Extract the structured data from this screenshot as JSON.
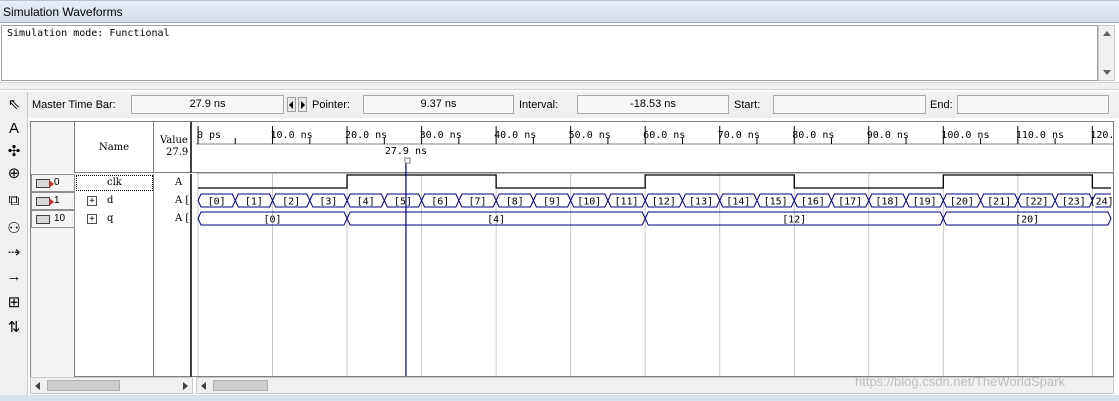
{
  "window": {
    "title": "Simulation Waveforms"
  },
  "messages": {
    "text": "Simulation mode: Functional"
  },
  "toolbar": {
    "tools": [
      {
        "name": "pointer-tool-icon",
        "glyph": "⇖"
      },
      {
        "name": "text-tool-icon",
        "glyph": "A"
      },
      {
        "name": "waveform-edit-icon",
        "glyph": "✣"
      },
      {
        "name": "zoom-tool-icon",
        "glyph": "⊕"
      },
      {
        "name": "copy-icon",
        "glyph": "⧉"
      },
      {
        "name": "find-icon",
        "glyph": "⚇"
      },
      {
        "name": "find-next-icon",
        "glyph": "⇢"
      },
      {
        "name": "next-transition-icon",
        "glyph": "→"
      },
      {
        "name": "group-icon",
        "glyph": "⊞"
      },
      {
        "name": "sort-icon",
        "glyph": "⇅"
      }
    ]
  },
  "timebar": {
    "master_label": "Master Time Bar:",
    "master_value": "27.9 ns",
    "pointer_label": "Pointer:",
    "pointer_value": "9.37 ns",
    "interval_label": "Interval:",
    "interval_value": "-18.53 ns",
    "start_label": "Start:",
    "start_value": "",
    "end_label": "End:",
    "end_value": ""
  },
  "columns": {
    "name": "Name",
    "value_line1": "Value",
    "value_line2": "27.9"
  },
  "signals": [
    {
      "id": "0",
      "name": "clk",
      "value": "A",
      "type": "in",
      "bus": false
    },
    {
      "id": "1",
      "name": "d",
      "value": "A [",
      "type": "in",
      "bus": true
    },
    {
      "id": "10",
      "name": "q",
      "value": "A [",
      "type": "out",
      "bus": true
    }
  ],
  "chart_data": {
    "type": "timing",
    "time_unit": "ns",
    "time_ticks": [
      "0 ps",
      "10.0 ns",
      "20.0 ns",
      "30.0 ns",
      "40.0 ns",
      "50.0 ns",
      "60.0 ns",
      "70.0 ns",
      "80.0 ns",
      "90.0 ns",
      "100.0 ns",
      "110.0 ns",
      "120.0 ns"
    ],
    "tick_values": [
      0,
      10,
      20,
      30,
      40,
      50,
      60,
      70,
      80,
      90,
      100,
      110,
      120
    ],
    "xlim": [
      0,
      122.5
    ],
    "master_time": 27.9,
    "master_label": "27.9 ns",
    "clk": {
      "period": 40,
      "high_start": 20,
      "high_duration": 20
    },
    "d": {
      "interval": 5,
      "values": [
        "[0]",
        "[1]",
        "[2]",
        "[3]",
        "[4]",
        "[5]",
        "[6]",
        "[7]",
        "[8]",
        "[9]",
        "[10]",
        "[11]",
        "[12]",
        "[13]",
        "[14]",
        "[15]",
        "[16]",
        "[17]",
        "[18]",
        "[19]",
        "[20]",
        "[21]",
        "[22]",
        "[23]",
        "[24]"
      ]
    },
    "q": {
      "segments": [
        {
          "start": 0,
          "end": 20,
          "value": "[0]"
        },
        {
          "start": 20,
          "end": 60,
          "value": "[4]"
        },
        {
          "start": 60,
          "end": 100,
          "value": "[12]"
        },
        {
          "start": 100,
          "end": 122.5,
          "value": "[20]"
        }
      ]
    }
  },
  "watermark": "https://blog.csdn.net/TheWorldSpark",
  "colors": {
    "wave": "#000080",
    "cursor": "#000080",
    "grid": "#c8c8c8"
  }
}
